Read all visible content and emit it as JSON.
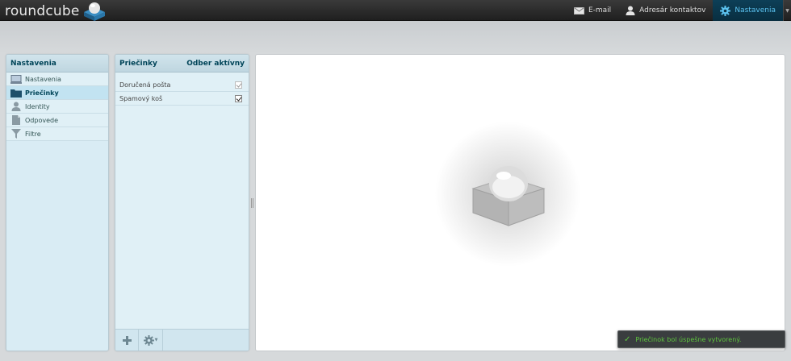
{
  "app": {
    "logo_text": "roundcube"
  },
  "topnav": {
    "email_label": "E-mail",
    "contacts_label": "Adresár kontaktov",
    "settings_label": "Nastavenia"
  },
  "settings_panel": {
    "title": "Nastavenia",
    "items": [
      {
        "label": "Nastavenia",
        "icon": "computer-icon"
      },
      {
        "label": "Priečinky",
        "icon": "folder-icon",
        "selected": true
      },
      {
        "label": "Identity",
        "icon": "person-icon"
      },
      {
        "label": "Odpovede",
        "icon": "document-icon"
      },
      {
        "label": "Filtre",
        "icon": "filter-icon"
      }
    ]
  },
  "folders_panel": {
    "title": "Priečinky",
    "subscribed_header": "Odber aktívny",
    "folders": [
      {
        "name": "Doručená pošta",
        "subscribed": true,
        "locked": true
      },
      {
        "name": "Spamový koš",
        "subscribed": true,
        "locked": false
      }
    ]
  },
  "notification": {
    "message": "Priečinok bol úspešne vytvorený."
  },
  "colors": {
    "accent": "#5cc3f0",
    "panel_bg": "#d9ecf4",
    "header_text": "#004458",
    "toast_text": "#5ec53e"
  }
}
